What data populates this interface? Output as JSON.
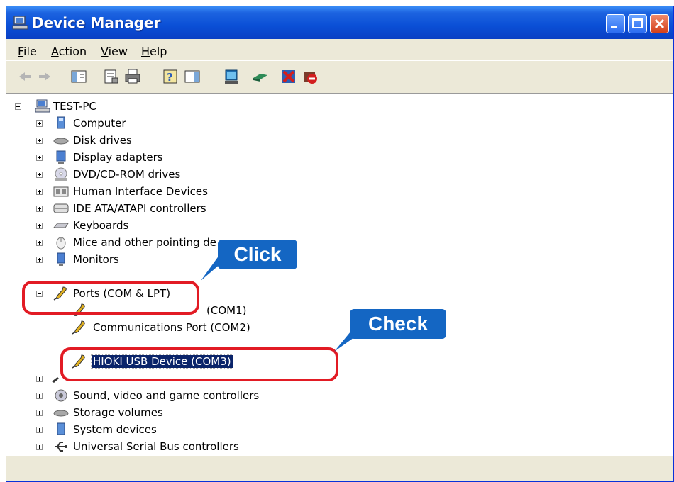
{
  "window": {
    "title": "Device Manager"
  },
  "menu": [
    {
      "label": "File",
      "accel": "F",
      "rest": "ile"
    },
    {
      "label": "Action",
      "accel": "A",
      "rest": "ction"
    },
    {
      "label": "View",
      "accel": "V",
      "rest": "iew"
    },
    {
      "label": "Help",
      "accel": "H",
      "rest": "elp"
    }
  ],
  "toolbar": {
    "icons": [
      "back-arrow-icon",
      "forward-arrow-icon",
      "show-hide-console-tree-icon",
      "properties-icon",
      "print-icon",
      "help-icon",
      "show-hide-action-pane-icon",
      "scan-hardware-icon",
      "update-driver-icon",
      "disable-device-icon",
      "uninstall-device-icon"
    ]
  },
  "tree": {
    "root": "TEST-PC",
    "categories": [
      {
        "label": "Computer",
        "icon": "computer-icon"
      },
      {
        "label": "Disk drives",
        "icon": "disk-drive-icon"
      },
      {
        "label": "Display adapters",
        "icon": "display-adapter-icon"
      },
      {
        "label": "DVD/CD-ROM drives",
        "icon": "dvd-drive-icon"
      },
      {
        "label": "Human Interface Devices",
        "icon": "hid-icon"
      },
      {
        "label": "IDE ATA/ATAPI controllers",
        "icon": "ide-controller-icon"
      },
      {
        "label": "Keyboards",
        "icon": "keyboard-icon"
      },
      {
        "label": "Mice and other pointing de",
        "icon": "mouse-icon"
      },
      {
        "label": "Monitors",
        "icon": "monitor-icon"
      }
    ],
    "ports": {
      "label": "Ports (COM & LPT)",
      "children": [
        {
          "label": "(COM1)",
          "icon": "port-icon"
        },
        {
          "label": "Communications Port (COM2)",
          "icon": "port-icon"
        },
        {
          "label": "HIOKI USB Device (COM3)",
          "icon": "port-icon",
          "selected": true
        }
      ]
    },
    "more_categories": [
      {
        "label": "",
        "icon": "processor-icon"
      },
      {
        "label": "Sound, video and game controllers",
        "icon": "sound-icon"
      },
      {
        "label": "Storage volumes",
        "icon": "storage-volume-icon"
      },
      {
        "label": "System devices",
        "icon": "system-device-icon"
      },
      {
        "label": "Universal Serial Bus controllers",
        "icon": "usb-icon"
      }
    ]
  },
  "annotations": {
    "click_label": "Click",
    "check_label": "Check",
    "accent_color": "#1466c3",
    "ring_color": "#e21b24"
  }
}
